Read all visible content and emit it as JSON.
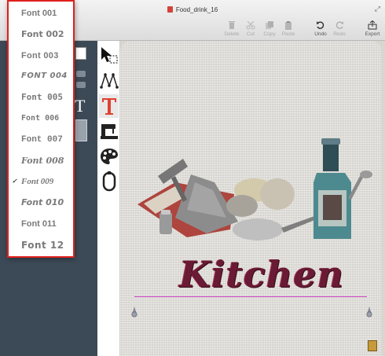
{
  "window": {
    "title": "Food_drink_16"
  },
  "toolbar": {
    "delete_label": "Delete",
    "cut_label": "Cut",
    "copy_label": "Copy",
    "paste_label": "Paste",
    "undo_label": "Undo",
    "redo_label": "Redo",
    "export_label": "Export"
  },
  "font_menu": {
    "items": [
      {
        "label": "Font 001",
        "selected": false
      },
      {
        "label": "Font 002",
        "selected": false
      },
      {
        "label": "Font 003",
        "selected": false
      },
      {
        "label": "FONT 004",
        "selected": false
      },
      {
        "label": "Font 005",
        "selected": false
      },
      {
        "label": "Font 006",
        "selected": false
      },
      {
        "label": "Font 007",
        "selected": false
      },
      {
        "label": "Font 008",
        "selected": false
      },
      {
        "label": "Font 009",
        "selected": true
      },
      {
        "label": "Font 010",
        "selected": false
      },
      {
        "label": "Font 011",
        "selected": false
      },
      {
        "label": "Font 12",
        "selected": false
      }
    ],
    "check_mark": "✓"
  },
  "canvas": {
    "text": "Kitchen"
  },
  "colors": {
    "menu_border": "#e0201c",
    "text_color": "#6a1a34",
    "baseline": "#d04ac8",
    "panel_bg": "#3c4a57"
  }
}
